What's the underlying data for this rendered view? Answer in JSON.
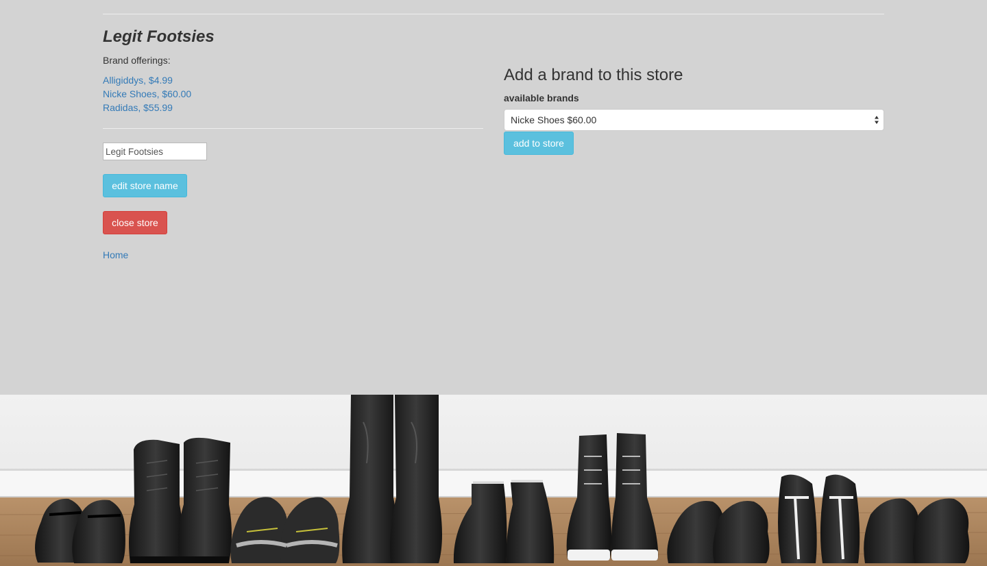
{
  "store": {
    "name": "Legit Footsies",
    "offerings_label": "Brand offerings:",
    "brands": [
      "Alligiddys, $4.99",
      "Nicke Shoes, $60.00",
      "Radidas, $55.99"
    ],
    "name_input_value": "Legit Footsies",
    "edit_label": "edit store name",
    "close_label": "close store",
    "home_label": "Home"
  },
  "add_brand": {
    "title": "Add a brand to this store",
    "select_label": "available brands",
    "selected_option": "Nicke Shoes $60.00",
    "submit_label": "add to store"
  },
  "icons": {
    "select": "updown-arrows-icon"
  },
  "hero_image": {
    "subject": "row of black shoes and boots on a wooden floor"
  },
  "colors": {
    "background": "#d3d3d3",
    "link": "#337ab7",
    "info_button": "#5bc0de",
    "danger_button": "#d9534f"
  }
}
